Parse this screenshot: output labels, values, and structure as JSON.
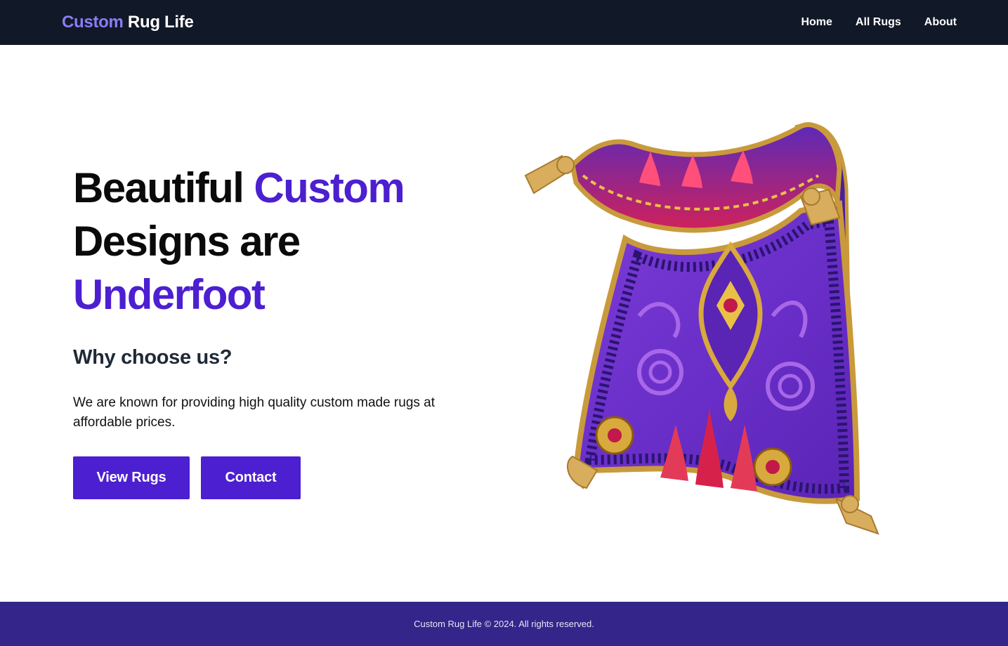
{
  "navbar": {
    "brand_part1": "Custom",
    "brand_part2": "Rug Life",
    "links": [
      "Home",
      "All Rugs",
      "About"
    ]
  },
  "hero": {
    "title_line1_a": "Beautiful",
    "title_line1_b": "Custom",
    "title_line2": "Designs are",
    "title_line3": "Underfoot",
    "subheading": "Why choose us?",
    "description": "We are known for providing high quality custom made rugs at affordable prices.",
    "buttons": [
      "View Rugs",
      "Contact"
    ],
    "image": "magic-carpet-rug"
  },
  "footer": {
    "text": "Custom Rug Life © 2024. All rights reserved."
  },
  "colors": {
    "nav_bg": "#111827",
    "brand_accent": "#8b7cf6",
    "primary": "#4c1fd1",
    "footer_bg": "#33258a"
  }
}
